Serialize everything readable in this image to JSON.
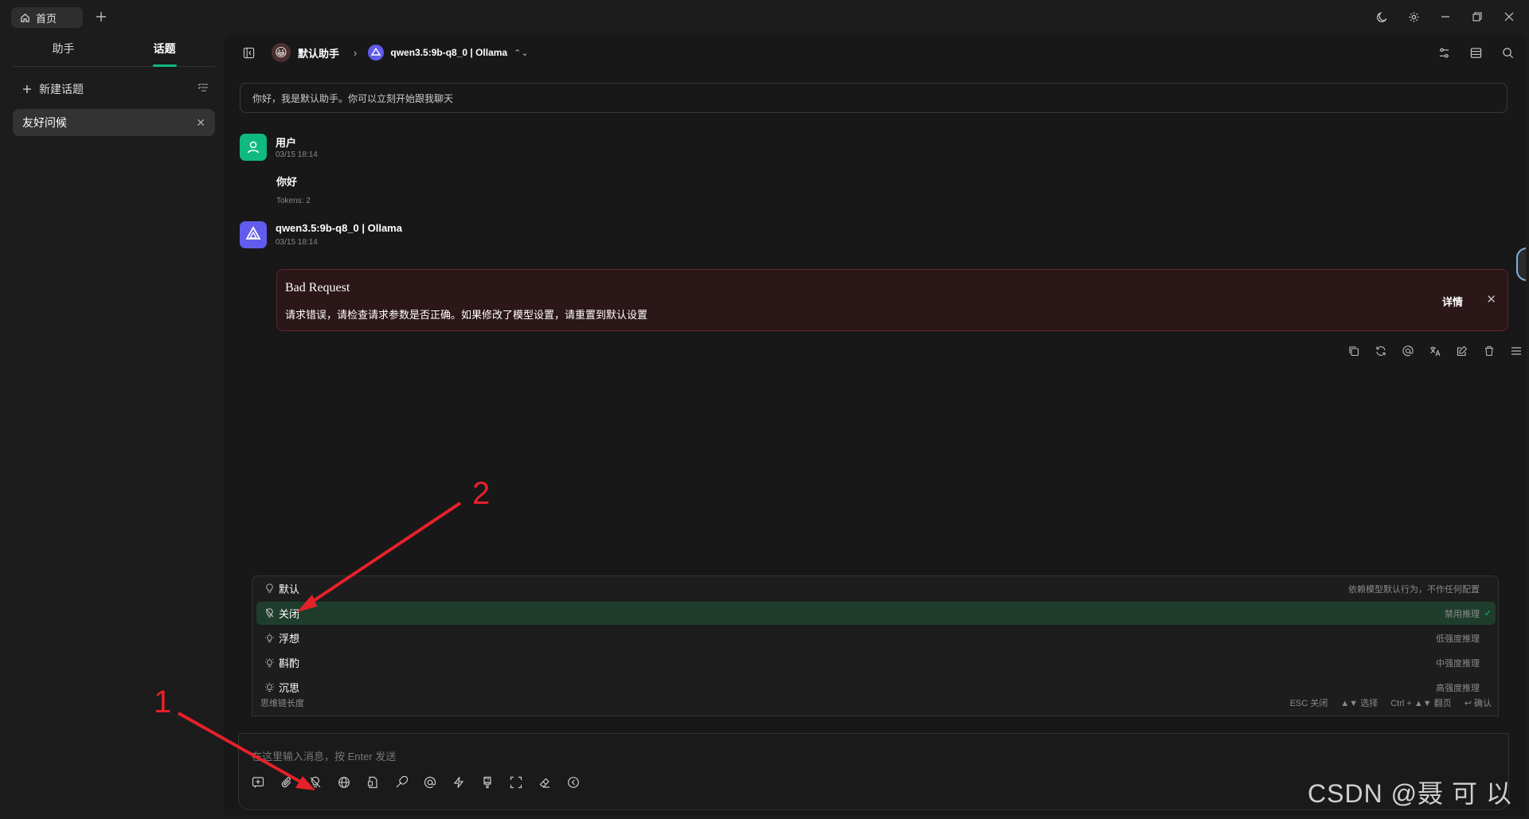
{
  "titlebar": {
    "home_tab": "首页"
  },
  "sidebar": {
    "tabs": [
      "助手",
      "话题"
    ],
    "active_tab": "话题",
    "new_topic": "新建话题",
    "topics": [
      {
        "label": "友好问候"
      }
    ]
  },
  "nav": {
    "assistant_name": "默认助手",
    "model_name": "qwen3.5:9b-q8_0 | Ollama"
  },
  "prompt": "你好，我是默认助手。你可以立刻开始跟我聊天",
  "messages": {
    "user": {
      "name": "用户",
      "time": "03/15 18:14",
      "text": "你好",
      "tokens": "Tokens: 2"
    },
    "assistant": {
      "name": "qwen3.5:9b-q8_0 | Ollama",
      "time": "03/15 18:14"
    }
  },
  "error": {
    "title": "Bad Request",
    "message": "请求错误，请检查请求参数是否正确。如果修改了模型设置，请重置到默认设置",
    "detail": "详情"
  },
  "reasoning_menu": {
    "items": [
      {
        "label": "默认",
        "hint": "依赖模型默认行为，不作任何配置"
      },
      {
        "label": "关闭",
        "hint": "禁用推理",
        "selected": true
      },
      {
        "label": "浮想",
        "hint": "低强度推理"
      },
      {
        "label": "斟酌",
        "hint": "中强度推理"
      },
      {
        "label": "沉思",
        "hint": "高强度推理"
      }
    ],
    "footer_label": "思维链长度",
    "footer_keys": [
      "ESC 关闭",
      "▲▼ 选择",
      "Ctrl + ▲▼ 翻页",
      "↩ 确认"
    ]
  },
  "input": {
    "placeholder": "在这里输入消息，按 Enter 发送"
  },
  "annotations": {
    "one": "1",
    "two": "2"
  },
  "watermark": "CSDN @聂 可 以",
  "colors": {
    "accent": "#10b981",
    "model_logo": "#615ced",
    "error_bg": "#2b1618",
    "annotation": "#e5212b"
  }
}
